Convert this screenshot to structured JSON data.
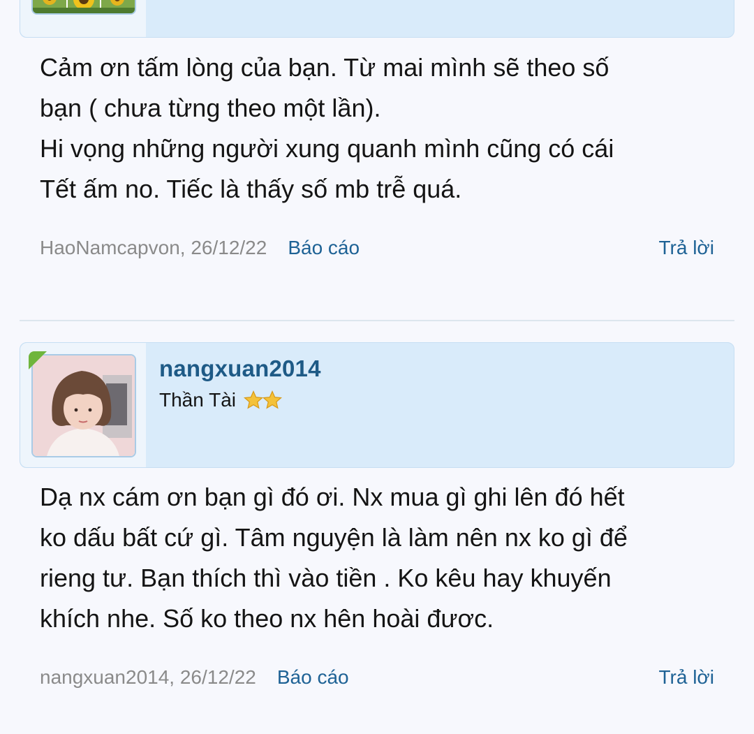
{
  "post1": {
    "avatar_alt": "sunflower-avatar",
    "lines": [
      "Cảm ơn tấm lòng của bạn. Từ mai mình sẽ theo số",
      "bạn ( chưa từng theo một lần).",
      "Hi vọng những người xung quanh mình cũng có cái",
      "Tết ấm no. Tiếc là thấy số mb trễ quá."
    ],
    "author_date": "HaoNamcapvon, 26/12/22",
    "report_label": "Báo cáo",
    "reply_label": "Trả lời"
  },
  "post2": {
    "username": "nangxuan2014",
    "rank": "Thần Tài",
    "stars": 2,
    "lines": [
      "Dạ nx cám ơn bạn gì đó ơi. Nx mua gì ghi lên đó hết",
      "ko dấu bất cứ gì. Tâm nguyện là làm nên nx ko gì để",
      "rieng tư. Bạn thích thì vào tiền . Ko kêu hay khuyến",
      "khích nhe. Số ko theo nx hên hoài đươc."
    ],
    "author_date": "nangxuan2014, 26/12/22",
    "report_label": "Báo cáo",
    "reply_label": "Trả lời"
  },
  "colors": {
    "username": "#1e5a86",
    "link": "#1e6295",
    "meta": "#8a8a8a",
    "user_bar": "#d9ebfa",
    "online": "#6fb53c"
  }
}
